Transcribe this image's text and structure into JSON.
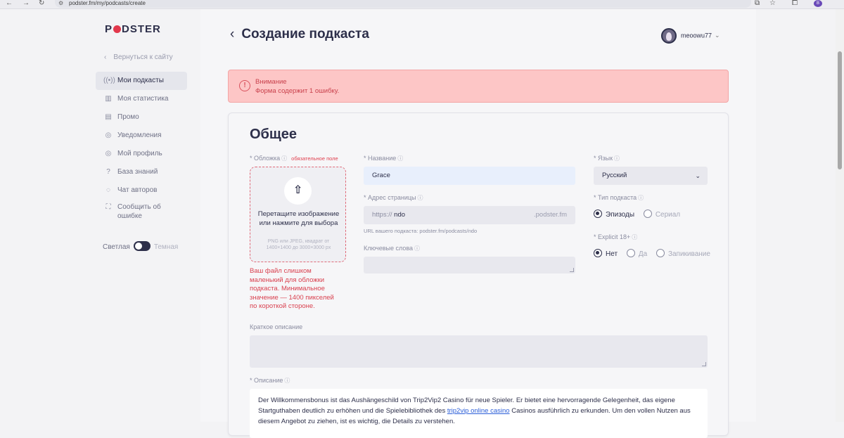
{
  "browser": {
    "url": "podster.fm/my/podcasts/create",
    "profile_initial": "B"
  },
  "sidebar": {
    "logo_left": "P",
    "logo_right": "DSTER",
    "back_link": "Вернуться к сайту",
    "items": [
      {
        "label": "Мои подкасты",
        "icon": "podcast-icon"
      },
      {
        "label": "Моя статистика",
        "icon": "chart-icon"
      },
      {
        "label": "Промо",
        "icon": "promo-icon"
      },
      {
        "label": "Уведомления",
        "icon": "bell-icon"
      },
      {
        "label": "Мой профиль",
        "icon": "user-icon"
      },
      {
        "label": "База знаний",
        "icon": "question-icon"
      },
      {
        "label": "Чат авторов",
        "icon": "chat-icon"
      },
      {
        "label": "Сообщить об ошибке",
        "icon": "bug-icon"
      }
    ],
    "theme_light": "Светлая",
    "theme_dark": "Темная"
  },
  "header": {
    "title": "Создание подкаста",
    "username": "meoowu77"
  },
  "alert": {
    "title": "Внимание",
    "text": "Форма содержит 1 ошибку."
  },
  "form": {
    "section_title": "Общее",
    "cover": {
      "label": "* Обложка",
      "required_tag": "обязательное поле",
      "dropzone_text": "Перетащите изображение или нажмите для выбора",
      "dropzone_hint": "PNG или JPEG, квадрат от 1400×1400 до 3000×3000 px",
      "error": "Ваш файл слишком маленький для обложки подкаста. Минимальное значение — 1400 пикселей по короткой стороне."
    },
    "name": {
      "label": "* Название",
      "value": "Grace"
    },
    "address": {
      "label": "* Адрес страницы",
      "prefix": "https://",
      "value": "ndo",
      "suffix": ".podster.fm",
      "hint": "URL вашего подкаста: podster.fm/podcasts/ndo"
    },
    "keywords": {
      "label": "Ключевые слова",
      "value": ""
    },
    "language": {
      "label": "* Язык",
      "value": "Русский"
    },
    "type": {
      "label": "* Тип подкаста",
      "options": [
        "Эпизоды",
        "Сериал"
      ],
      "selected": "Эпизоды"
    },
    "explicit": {
      "label": "* Explicit 18+",
      "options": [
        "Нет",
        "Да",
        "Запикивание"
      ],
      "selected": "Нет"
    },
    "short_desc": {
      "label": "Краткое описание",
      "value": ""
    },
    "description": {
      "label": "* Описание",
      "text_part1": "Der Willkommensbonus ist das Aushängeschild von Trip2Vip2 Casino für neue Spieler. Er bietet eine hervorragende Gelegenheit, das eigene Startguthaben deutlich zu erhöhen und die Spielebibliothek des ",
      "link_text": "trip2vip online casino",
      "text_part2": "  Casinos ausführlich zu erkunden. Um den vollen Nutzen aus diesem Angebot zu ziehen, ist es wichtig, die Details zu verstehen."
    }
  },
  "colors": {
    "accent": "#2d2f4a",
    "error": "#d9414f",
    "alert_bg": "#fdc6c6",
    "logo_dot": "#e2384c"
  }
}
